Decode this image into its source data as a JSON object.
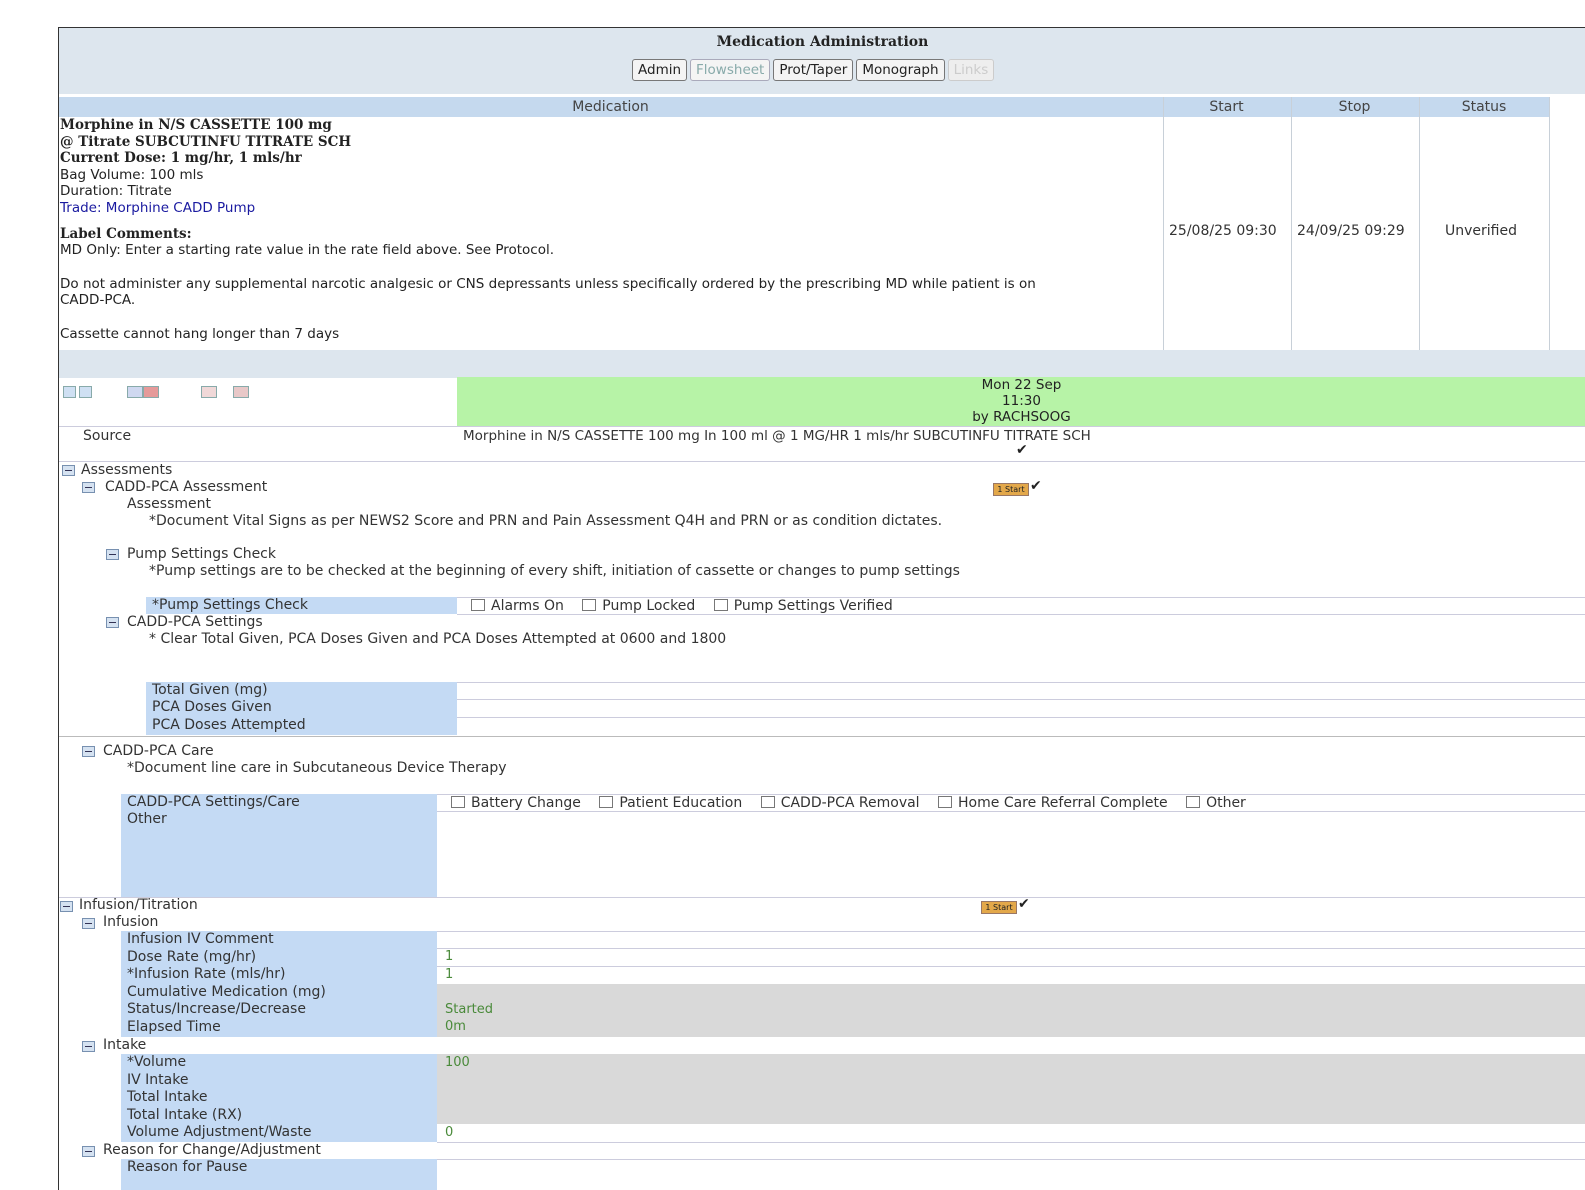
{
  "window": {
    "title": "Medication Administration"
  },
  "tabs": [
    {
      "label": "Admin"
    },
    {
      "label": "Flowsheet"
    },
    {
      "label": "Prot/Taper"
    },
    {
      "label": "Monograph"
    },
    {
      "label": "Links"
    }
  ],
  "medication_table": {
    "headers": {
      "medication": "Medication",
      "start": "Start",
      "stop": "Stop",
      "status": "Status"
    },
    "lines": {
      "name": "Morphine in N/S CASSETTE 100 mg",
      "route": "@ Titrate SUBCUTINFU TITRATE SCH",
      "current_dose": "Current Dose: 1 mg/hr, 1 mls/hr",
      "bag_volume": "Bag Volume: 100 mls",
      "duration": "Duration: Titrate",
      "trade": "Trade: Morphine CADD Pump",
      "label_comments_heading": "Label Comments:",
      "comment_1": "MD Only: Enter a starting rate value in the rate field  above. See Protocol.",
      "comment_2a": "Do not administer any supplemental narcotic analgesic or CNS  depressants unless specifically ordered by the prescribing  MD while patient is on",
      "comment_2b": "CADD-PCA.",
      "comment_3": "Cassette cannot hang longer than 7 days"
    },
    "start": "25/08/25 09:30",
    "stop": "24/09/25 09:29",
    "status": "Unverified"
  },
  "flowsheet": {
    "column": {
      "date": "Mon 22 Sep",
      "time": "11:30",
      "by": "by RACHSOOG"
    },
    "source_label": "Source",
    "source_value": "Morphine in N/S CASSETTE 100 mg In 100 ml @ 1 MG/HR 1 mls/hr SUBCUTINFU TITRATE SCH",
    "check_mark": "✔",
    "badge_label": "1 Start",
    "assessments": {
      "label": "Assessments",
      "cadd_pca_assessment": "CADD-PCA Assessment",
      "assessment_label": "Assessment",
      "assessment_note": "*Document Vital Signs as per NEWS2 Score and PRN and Pain Assessment Q4H and PRN or as condition dictates.",
      "pump_settings_check_group": "Pump Settings Check",
      "pump_settings_note": "*Pump settings are to be checked at the beginning of every shift, initiation of cassette or changes to pump settings",
      "pump_settings_check_field": "*Pump Settings Check",
      "pump_options": [
        "Alarms On",
        "Pump Locked",
        "Pump Settings Verified"
      ],
      "cadd_pca_settings": "CADD-PCA Settings",
      "settings_note": "* Clear Total Given, PCA Doses Given and PCA Doses Attempted at 0600 and 1800",
      "total_given": "Total Given (mg)",
      "pca_doses_given": "PCA Doses Given",
      "pca_doses_attempted": "PCA Doses Attempted",
      "cadd_pca_care": "CADD-PCA Care",
      "care_note": "*Document line care in Subcutaneous Device Therapy",
      "settings_care_field": "CADD-PCA Settings/Care",
      "care_options": [
        "Battery Change",
        "Patient Education",
        "CADD-PCA Removal",
        "Home Care Referral Complete",
        "Other"
      ],
      "other_field": "Other"
    },
    "infusion_titration": {
      "label": "Infusion/Titration",
      "infusion_group": "Infusion",
      "rows": [
        {
          "label": "Infusion IV Comment",
          "value": ""
        },
        {
          "label": "Dose Rate (mg/hr)",
          "value": "1"
        },
        {
          "label": "*Infusion Rate (mls/hr)",
          "value": "1"
        },
        {
          "label": "Cumulative Medication (mg)",
          "value": ""
        },
        {
          "label": "Status/Increase/Decrease",
          "value": "Started"
        },
        {
          "label": "Elapsed Time",
          "value": "0m"
        }
      ],
      "intake_group": "Intake",
      "intake_rows": [
        {
          "label": "*Volume",
          "value": "100"
        },
        {
          "label": "IV Intake",
          "value": ""
        },
        {
          "label": "Total Intake",
          "value": ""
        },
        {
          "label": "Total Intake (RX)",
          "value": ""
        },
        {
          "label": "Volume Adjustment/Waste",
          "value": "0"
        }
      ],
      "reason_group": "Reason for Change/Adjustment",
      "reason_pause": "Reason for Pause"
    }
  }
}
